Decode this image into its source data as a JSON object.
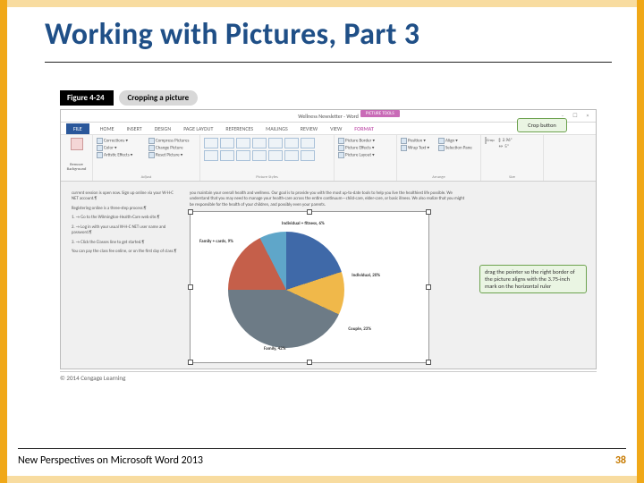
{
  "slide": {
    "title": "Working with Pictures, Part 3"
  },
  "figure": {
    "label": "Figure 4-24",
    "title": "Cropping a picture"
  },
  "window": {
    "title": "Wellness Newsletter - Word",
    "picture_tools": "PICTURE TOOLS",
    "controls": {
      "min": "–",
      "max": "☐",
      "close": "×"
    }
  },
  "tabs": {
    "file": "FILE",
    "items": [
      "HOME",
      "INSERT",
      "DESIGN",
      "PAGE LAYOUT",
      "REFERENCES",
      "MAILINGS",
      "REVIEW",
      "VIEW"
    ],
    "format": "FORMAT"
  },
  "ribbon": {
    "remove_bg": "Remove Background",
    "adjust": {
      "items": [
        "Corrections ▾",
        "Color ▾",
        "Artistic Effects ▾",
        "Compress Pictures",
        "Change Picture",
        "Reset Picture ▾"
      ],
      "label": "Adjust"
    },
    "styles_label": "Picture Styles",
    "border_group": [
      "Picture Border ▾",
      "Picture Effects ▾",
      "Picture Layout ▾"
    ],
    "arrange": {
      "items": [
        "Position ▾",
        "Wrap Text ▾",
        "Align ▾",
        "Selection Pane"
      ],
      "label": "Arrange"
    },
    "size": {
      "crop": "Crop",
      "h": "2.96\"",
      "w": "5\"",
      "label": "Size"
    }
  },
  "callouts": {
    "crop": "Crop button",
    "drag": "drag the pointer so the right border of the picture aligns with the 3.75-inch mark on the horizontal ruler"
  },
  "doc": {
    "left1": "current session is open now. Sign up online via your W-H-C NET account.¶",
    "left2": "Registering online is a three-step process:¶",
    "left3": "1. → Go to the Wilmington-Health-Care web site.¶",
    "left4": "2. → Log in with your usual W-H-C NET user name and password.¶",
    "left5": "3. → Click the Classes line to get started.¶",
    "left6": "You can pay the class fee online, or on the first day of class.¶",
    "right_top": "you maintain your overall health and wellness. Our goal is to provide you with the most up-to-date tools to help you live the healthiest life possible. We understand that you may need to manage your health-care across the entire continuum—child-care, elder-care, or basic illness. We also realize that you might be responsible for the health of your children, and possibly even your parents."
  },
  "chart_data": {
    "type": "pie",
    "title": "",
    "series": [
      {
        "name": "Individual + fitness",
        "value": 6
      },
      {
        "name": "Family + cards",
        "value": 9
      },
      {
        "name": "Individual",
        "value": 20
      },
      {
        "name": "Family",
        "value": 42
      },
      {
        "name": "Couple",
        "value": 23
      }
    ],
    "labels": {
      "sl1": "Individual + fitness, 6%",
      "sl2": "Family + cards, 9%",
      "sl3": "Individual, 20%",
      "sl4": "Family, 42%",
      "sl5": "Couple, 23%"
    }
  },
  "attribution": "© 2014 Cengage Learning",
  "footer": {
    "book": "New Perspectives on Microsoft Word 2013",
    "page": "38"
  }
}
